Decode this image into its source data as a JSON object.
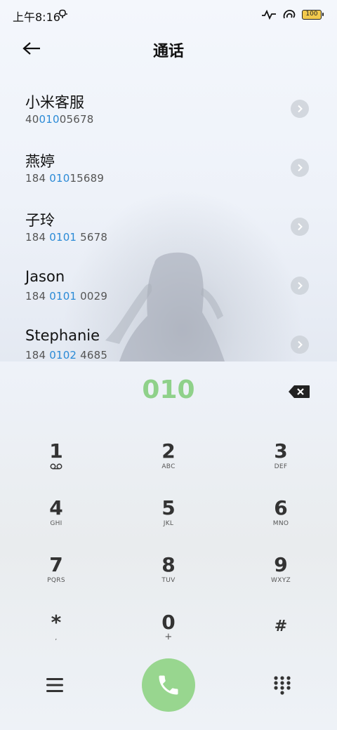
{
  "status_bar": {
    "time": "上午8:16",
    "battery": "100"
  },
  "header": {
    "title": "通话"
  },
  "contacts": [
    {
      "name": "小米客服",
      "number_parts": [
        "40",
        "010",
        "05678"
      ]
    },
    {
      "name": "燕婷",
      "number_parts": [
        "184 ",
        "010",
        "15689"
      ]
    },
    {
      "name": "子玲",
      "number_parts": [
        "184 ",
        "0101",
        " 5678"
      ]
    },
    {
      "name": "Jason",
      "number_parts": [
        "184 ",
        "0101",
        " 0029"
      ]
    },
    {
      "name": "Stephanie",
      "number_parts": [
        "184 ",
        "0102",
        " 4685"
      ]
    }
  ],
  "dialer": {
    "input": "010"
  },
  "keypad": [
    {
      "digit": "1",
      "letters": "voicemail-icon"
    },
    {
      "digit": "2",
      "letters": "ABC"
    },
    {
      "digit": "3",
      "letters": "DEF"
    },
    {
      "digit": "4",
      "letters": "GHI"
    },
    {
      "digit": "5",
      "letters": "JKL"
    },
    {
      "digit": "6",
      "letters": "MNO"
    },
    {
      "digit": "7",
      "letters": "PQRS"
    },
    {
      "digit": "8",
      "letters": "TUV"
    },
    {
      "digit": "9",
      "letters": "WXYZ"
    },
    {
      "digit": "*",
      "letters": ","
    },
    {
      "digit": "0",
      "letters": "+"
    },
    {
      "digit": "#",
      "letters": ""
    }
  ],
  "colors": {
    "match_highlight": "#2a8ad6",
    "dialed_text": "#8fd18a",
    "call_button": "#98d68f"
  }
}
